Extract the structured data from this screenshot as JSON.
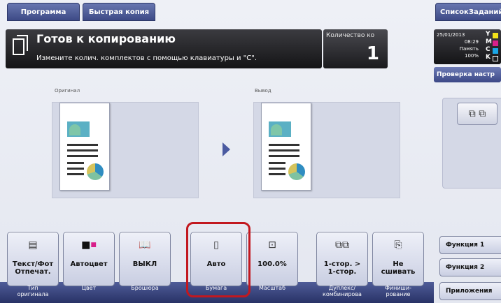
{
  "tabs": {
    "program": "Программа",
    "quick_copy": "Быстрая копия",
    "job_list": "СписокЗаданий"
  },
  "status": {
    "title": "Готов к копированию",
    "message": "Измените колич. комплектов с помощью клавиатуры и \"C\"."
  },
  "count": {
    "label": "Количество ко",
    "value": "1"
  },
  "info": {
    "date": "25/01/2013",
    "time": "08:29",
    "paper": "Память",
    "percent": "100%",
    "toner": [
      "Y",
      "M",
      "C",
      "K"
    ]
  },
  "check_settings": "Проверка настр",
  "preview": {
    "original_caption": "Оригинал",
    "output_caption": "Вывод"
  },
  "colors": {
    "toner_y": "#f2e21a",
    "toner_m": "#d8208a",
    "toner_c": "#1aa6e6",
    "toner_k": "#ffffff",
    "highlight": "#c2181f"
  },
  "functions": [
    {
      "icon": "text-photo-icon",
      "label": "Текст/Фот\nОтпечат.",
      "caption": "Тип\nоригинала"
    },
    {
      "icon": "color-icon",
      "label": "Автоцвет",
      "caption": "Цвет"
    },
    {
      "icon": "booklet-icon",
      "label": "ВЫКЛ",
      "caption": "Брошюра"
    },
    {
      "icon": "paper-icon",
      "label": "Авто",
      "caption": "Бумага"
    },
    {
      "icon": "zoom-icon",
      "label": "100.0%",
      "caption": "Масштаб"
    },
    {
      "icon": "duplex-icon",
      "label": "1-стор. >\n1-стор.",
      "caption": "Дуплекс/\nкомбинирова"
    },
    {
      "icon": "staple-icon",
      "label": "Не\nсшивать",
      "caption": "Финиши-\nрование"
    }
  ],
  "right_buttons": {
    "func1": "Функция 1",
    "func2": "Функция 2",
    "apps": "Приложения"
  }
}
